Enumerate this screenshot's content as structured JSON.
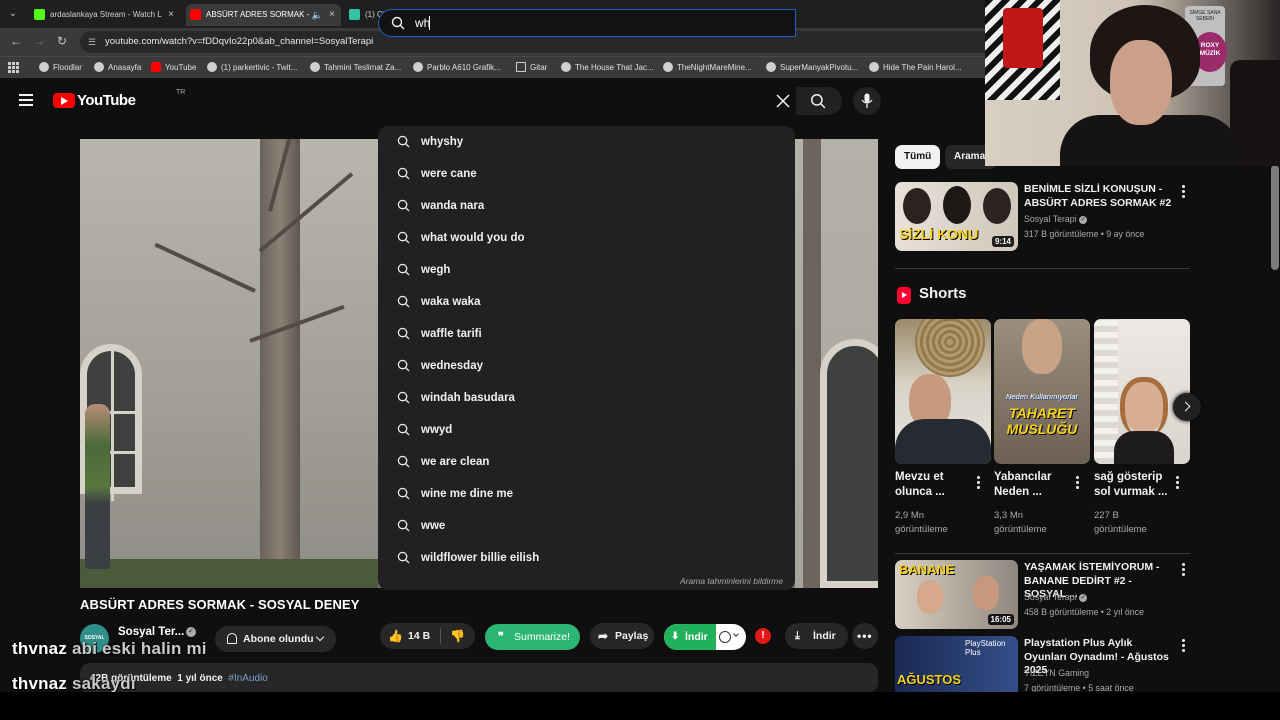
{
  "browser": {
    "tabs": [
      {
        "title": "ardaslankaya Stream - Watch L",
        "favicon_color": "#53fc18",
        "active": false
      },
      {
        "title": "ABSÜRT ADRES SORMAK -",
        "favicon_color": "#ff0000",
        "active": true
      },
      {
        "title": "(1) Chat Box / Streamlabs",
        "favicon_color": "#31c3a2",
        "active": false
      }
    ],
    "new_tab_glyph": "+",
    "close_glyph": "×",
    "url": "youtube.com/watch?v=fDDqvIo22p0&ab_channel=SosyalTerapi",
    "bookmarks": [
      "Floodlar",
      "Anasayfa",
      "YouTube",
      "(1) parkertivic - Twit...",
      "Tahmini Teslimat Za...",
      "Parblo A610 Grafik...",
      "Gitar",
      "The House That Jac...",
      "TheNightMareMine...",
      "SuperManyakPivotu...",
      "Hide The Pain Harol..."
    ]
  },
  "youtube": {
    "logo_text": "YouTube",
    "country_code": "TR",
    "search": {
      "query": "wh",
      "suggestions": [
        "whyshy",
        "were cane",
        "wanda nara",
        "what would you do",
        "wegh",
        "waka waka",
        "waffle tarifi",
        "wednesday",
        "windah basudara",
        "wwyd",
        "we are clean",
        "wine me dine me",
        "wwe",
        "wildflower billie eilish"
      ],
      "report_label": "Arama tahminlerini bildirme"
    },
    "video": {
      "title": "ABSÜRT ADRES SORMAK - SOSYAL DENEY",
      "channel": "Sosyal Ter...",
      "avatar_text": "SOSYAL TERAPİ",
      "subscribe_label": "Abone olundu",
      "likes": "14 B",
      "summarize_label": "Summarize!",
      "share_label": "Paylaş",
      "download_green_label": "İndir",
      "download_label": "İndir",
      "views_prefix": "42",
      "views": "B görüntüleme",
      "age": "1 yıl önce",
      "tag": "#InAudio"
    },
    "chips": [
      "Tümü",
      "Aramal"
    ],
    "recommended": [
      {
        "title": "BENİMLE SİZLİ KONUŞUN - ABSÜRT ADRES SORMAK #2",
        "channel": "Sosyal Terapi",
        "meta": "317 B görüntüleme • 9 ay önce",
        "duration": "9:14",
        "thumb_text": "SİZLİ KONU"
      },
      {
        "title": "YAŞAMAK İSTEMİYORUM - BANANE DEDİRT #2 - SOSYAL ...",
        "channel": "Sosyal Terapi",
        "meta": "458 B görüntüleme • 2 yıl önce",
        "duration": "16:05",
        "thumb_text": "BANANE"
      },
      {
        "title": "Playstation Plus Aylık Oyunları Oynadım! - Ağustos 2025",
        "channel": "YIZEYN Gaming",
        "meta": "7 görüntüleme • 5 saat önce",
        "duration": "",
        "thumb_text": "AĞUSTOS"
      }
    ],
    "shorts": {
      "label": "Shorts",
      "items": [
        {
          "title": "Mevzu et olunca ...",
          "views": "2,9 Mn görüntüleme",
          "thumb_text": ""
        },
        {
          "title": "Yabancılar Neden ...",
          "views": "3,3 Mn görüntüleme",
          "thumb_text": "TAHARET MUSLUĞU",
          "thumb_sub": "Neden Kullanmıyorlar"
        },
        {
          "title": "sağ gösterip sol vurmak ...",
          "views": "227 B görüntüleme",
          "thumb_text": ""
        }
      ]
    }
  },
  "chat_overlay": [
    {
      "user": "thvnaz",
      "message": "abi eski halin mi"
    },
    {
      "user": "thvnaz",
      "message": "sakaydı"
    }
  ],
  "webcam": {
    "sign_text": "SİMGE SANA SEBEBİ",
    "badge_text": "ROXY MÜZİK"
  },
  "colors": {
    "accent_blue": "#1c62b9",
    "youtube_red": "#ff0000",
    "summarize_green": "#2bb673",
    "download_green": "#20b15a"
  }
}
